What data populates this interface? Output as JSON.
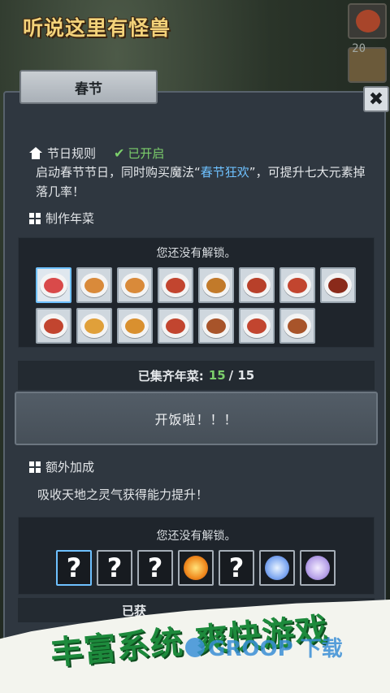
{
  "game": {
    "logo_text": "听说这里有怪兽"
  },
  "side": {
    "slot_count": "20"
  },
  "tab": {
    "title": "春节"
  },
  "close": {
    "label": "✖"
  },
  "rule": {
    "heading": "节日规则",
    "status": "已开启",
    "desc_part1": "启动春节节日，同时购买魔法“",
    "desc_highlight": "春节狂欢",
    "desc_part2": "”，可提升七大元素掉落几率！"
  },
  "dishes_section": {
    "heading": "制作年菜",
    "unlock_note": "您还没有解锁。",
    "dish_colors": [
      "#d94a4a",
      "#d98a3a",
      "#d98a3a",
      "#c2452f",
      "#c27a2a",
      "#b8402a",
      "#c2452f",
      "#8a2a1a",
      "#c2452f",
      "#e0a03a",
      "#d9902f",
      "#c2452f",
      "#a8542a",
      "#c2452f",
      "#a8542a"
    ],
    "collected_label": "已集齐年菜:",
    "collected_count": "15",
    "collected_total": "/ 15"
  },
  "eat_button": {
    "label": "开饭啦！！！"
  },
  "bonus_section": {
    "heading": "额外加成",
    "desc": "吸收天地之灵气获得能力提升！",
    "unlock_note": "您还没有解锁。",
    "slots": [
      "?",
      "?",
      "?",
      "orb-orange",
      "?",
      "orb-blue",
      "orb-purple"
    ],
    "collected_label_partial": "已获"
  },
  "promo": {
    "banner_text": "丰富系统 爽快游戏",
    "watermark": "GROOP 下载"
  },
  "colors": {
    "highlight": "#6ec1ff",
    "status_green": "#7ccf6b",
    "promo_green": "#1d8a3c"
  }
}
